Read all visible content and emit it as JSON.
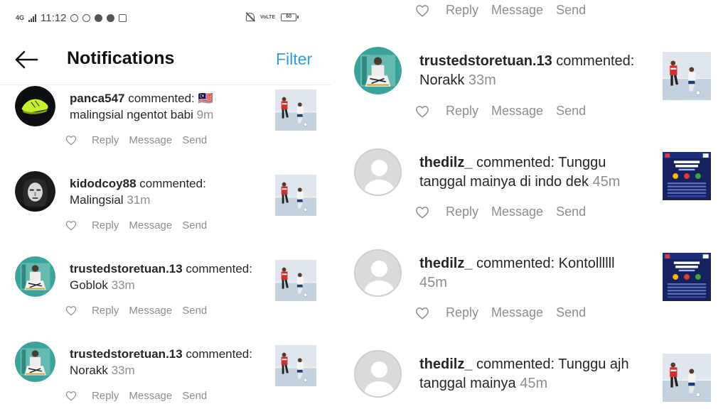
{
  "status_bar": {
    "network": "4G",
    "time": "11:12",
    "volte": "VoLTE",
    "battery": "60"
  },
  "header": {
    "title": "Notifications",
    "filter_label": "Filter"
  },
  "actions": {
    "reply": "Reply",
    "message": "Message",
    "send": "Send"
  },
  "left_notifications": [
    {
      "username": "panca547",
      "action": " commented: ",
      "comment": "🇲🇾 malingsial ngentot babi",
      "time": "9m"
    },
    {
      "username": "kidodcoy88",
      "action": " commented: ",
      "comment": "Malingsial",
      "time": "31m"
    },
    {
      "username": "trustedstoretuan.13",
      "action": " commented: ",
      "comment": "Goblok",
      "time": "33m"
    },
    {
      "username": "trustedstoretuan.13",
      "action": " commented: ",
      "comment": "Norakk",
      "time": "33m"
    }
  ],
  "right_notifications": [
    {
      "username": "trustedstoretuan.13",
      "action": " commented: ",
      "comment": "Norakk",
      "time": "33m"
    },
    {
      "username": "thedilz_",
      "action": " commented: ",
      "comment": "Tunggu tanggal mainya di indo dek",
      "time": "45m"
    },
    {
      "username": "thedilz_",
      "action": " commented: ",
      "comment": "Kontollllll",
      "time": "45m"
    },
    {
      "username": "thedilz_",
      "action": " commented: ",
      "comment": "Tunggu ajh tanggal mainya",
      "time": "45m"
    }
  ],
  "colors": {
    "accent": "#2f9be3",
    "text": "#262626",
    "muted": "#8e8e8e"
  }
}
